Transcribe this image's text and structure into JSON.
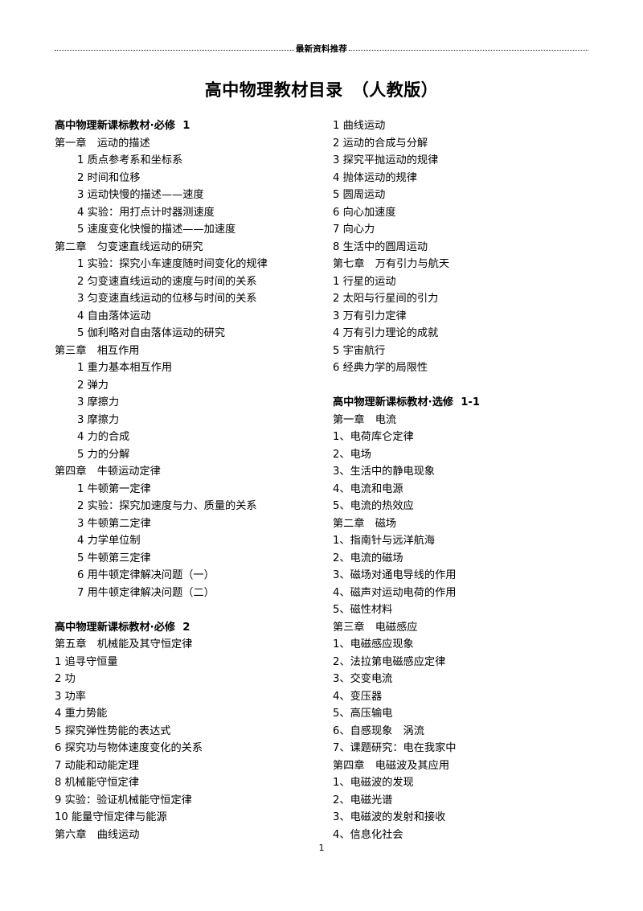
{
  "header": {
    "text": "最新资料推荐",
    "rule_style": "dotted"
  },
  "title": "高中物理教材目录　（人教版）",
  "footer": {
    "page_number": "1"
  },
  "columns": {
    "left": [
      {
        "type": "book",
        "text": "高中物理新课标教材·必修  1"
      },
      {
        "type": "chapter",
        "text": "第一章　运动的描述"
      },
      {
        "type": "item",
        "text": "1 质点参考系和坐标系"
      },
      {
        "type": "item",
        "text": "2 时间和位移"
      },
      {
        "type": "item",
        "text": "3 运动快慢的描述——速度"
      },
      {
        "type": "item",
        "text": "4 实验：用打点计时器测速度"
      },
      {
        "type": "item",
        "text": "5 速度变化快慢的描述——加速度"
      },
      {
        "type": "chapter",
        "text": "第二章　匀变速直线运动的研究"
      },
      {
        "type": "item",
        "text": "1 实验：探究小车速度随时间变化的规律"
      },
      {
        "type": "item",
        "text": "2 匀变速直线运动的速度与时间的关系"
      },
      {
        "type": "item",
        "text": "3 匀变速直线运动的位移与时间的关系"
      },
      {
        "type": "item",
        "text": "4 自由落体运动"
      },
      {
        "type": "item",
        "text": "5 伽利略对自由落体运动的研究"
      },
      {
        "type": "chapter",
        "text": "第三章　相互作用"
      },
      {
        "type": "item",
        "text": "1 重力基本相互作用"
      },
      {
        "type": "item",
        "text": "2 弹力"
      },
      {
        "type": "item",
        "text": "3 摩擦力"
      },
      {
        "type": "item",
        "text": "3 摩擦力"
      },
      {
        "type": "item",
        "text": "4 力的合成"
      },
      {
        "type": "item",
        "text": "5 力的分解"
      },
      {
        "type": "chapter",
        "text": "第四章　牛顿运动定律"
      },
      {
        "type": "item",
        "text": "1 牛顿第一定律"
      },
      {
        "type": "item",
        "text": "2 实验：探究加速度与力、质量的关系"
      },
      {
        "type": "item",
        "text": "3 牛顿第二定律"
      },
      {
        "type": "item",
        "text": "4 力学单位制"
      },
      {
        "type": "item",
        "text": "5 牛顿第三定律"
      },
      {
        "type": "item",
        "text": "6 用牛顿定律解决问题（一）"
      },
      {
        "type": "item",
        "text": "7 用牛顿定律解决问题（二）"
      },
      {
        "type": "spacer",
        "text": ""
      },
      {
        "type": "book",
        "text": "高中物理新课标教材·必修  2"
      },
      {
        "type": "chapter",
        "text": "第五章　机械能及其守恒定律"
      },
      {
        "type": "flush",
        "text": "1 追寻守恒量"
      },
      {
        "type": "flush",
        "text": "2 功"
      },
      {
        "type": "flush",
        "text": "3 功率"
      },
      {
        "type": "flush",
        "text": "4 重力势能"
      },
      {
        "type": "flush",
        "text": "5 探究弹性势能的表达式"
      },
      {
        "type": "flush",
        "text": "6 探究功与物体速度变化的关系"
      },
      {
        "type": "flush",
        "text": "7 动能和动能定理"
      },
      {
        "type": "flush",
        "text": "8 机械能守恒定律"
      },
      {
        "type": "flush",
        "text": "9 实验：验证机械能守恒定律"
      },
      {
        "type": "flush",
        "text": "10 能量守恒定律与能源"
      },
      {
        "type": "chapter",
        "text": "第六章　曲线运动"
      }
    ],
    "right": [
      {
        "type": "flush",
        "text": "1 曲线运动"
      },
      {
        "type": "flush",
        "text": "2 运动的合成与分解"
      },
      {
        "type": "flush",
        "text": "3 探究平抛运动的规律"
      },
      {
        "type": "flush",
        "text": "4 抛体运动的规律"
      },
      {
        "type": "flush",
        "text": "5 圆周运动"
      },
      {
        "type": "flush",
        "text": "6 向心加速度"
      },
      {
        "type": "flush",
        "text": "7 向心力"
      },
      {
        "type": "flush",
        "text": "8 生活中的圆周运动"
      },
      {
        "type": "chapter",
        "text": "第七章　万有引力与航天"
      },
      {
        "type": "flush",
        "text": "1 行星的运动"
      },
      {
        "type": "flush",
        "text": "2 太阳与行星间的引力"
      },
      {
        "type": "flush",
        "text": "3 万有引力定律"
      },
      {
        "type": "flush",
        "text": "4 万有引力理论的成就"
      },
      {
        "type": "flush",
        "text": "5 宇宙航行"
      },
      {
        "type": "flush",
        "text": "6 经典力学的局限性"
      },
      {
        "type": "spacer",
        "text": ""
      },
      {
        "type": "book",
        "text": "高中物理新课标教材·选修  1-1"
      },
      {
        "type": "chapter",
        "text": "第一章　电流"
      },
      {
        "type": "flush",
        "text": "1、电荷库仑定律"
      },
      {
        "type": "flush",
        "text": "2、电场"
      },
      {
        "type": "flush",
        "text": "3、生活中的静电现象"
      },
      {
        "type": "flush",
        "text": "4、电流和电源"
      },
      {
        "type": "flush",
        "text": "5、电流的热效应"
      },
      {
        "type": "chapter",
        "text": "第二章　磁场"
      },
      {
        "type": "flush",
        "text": "1、指南针与远洋航海"
      },
      {
        "type": "flush",
        "text": "2、电流的磁场"
      },
      {
        "type": "flush",
        "text": "3、磁场对通电导线的作用"
      },
      {
        "type": "flush",
        "text": "4、磁声对运动电荷的作用"
      },
      {
        "type": "flush",
        "text": "5、磁性材料"
      },
      {
        "type": "chapter",
        "text": "第三章　电磁感应"
      },
      {
        "type": "flush",
        "text": "1、电磁感应现象"
      },
      {
        "type": "flush",
        "text": "2、法拉第电磁感应定律"
      },
      {
        "type": "flush",
        "text": "3、交变电流"
      },
      {
        "type": "flush",
        "text": "4、变压器"
      },
      {
        "type": "flush",
        "text": "5、高压输电"
      },
      {
        "type": "flush",
        "text": "6、自感现象　涡流"
      },
      {
        "type": "flush",
        "text": "7、课题研究：电在我家中"
      },
      {
        "type": "chapter",
        "text": "第四章　电磁波及其应用"
      },
      {
        "type": "flush",
        "text": "1、电磁波的发现"
      },
      {
        "type": "flush",
        "text": "2、电磁光谱"
      },
      {
        "type": "flush",
        "text": "3、电磁波的发射和接收"
      },
      {
        "type": "flush",
        "text": "4、信息化社会"
      }
    ]
  }
}
